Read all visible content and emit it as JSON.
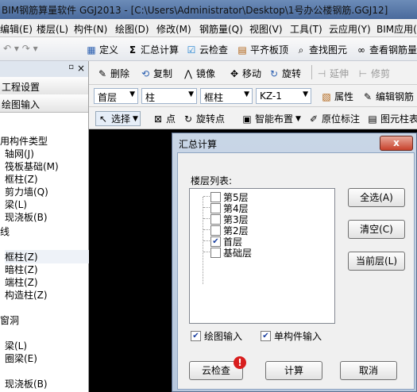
{
  "window": {
    "title": "BIM钢筋算量软件 GGJ2013 - [C:\\Users\\Administrator\\Desktop\\1号办公楼钢筋.GGJ12]"
  },
  "menubar": {
    "items": [
      "编辑(E)",
      "楼层(L)",
      "构件(N)",
      "绘图(D)",
      "修改(M)",
      "钢筋量(Q)",
      "视图(V)",
      "工具(T)",
      "云应用(Y)",
      "BIM应用("
    ]
  },
  "toolbar1": {
    "define": "定义",
    "summary": "汇总计算",
    "cloud_check": "云检查",
    "flush_slab": "平齐板顶",
    "find_element": "查找图元",
    "view_rebar": "查看钢筋量"
  },
  "edit_toolbar": {
    "delete": "删除",
    "copy": "复制",
    "mirror": "镜像",
    "move": "移动",
    "rotate": "旋转",
    "extend": "延伸",
    "trim": "修剪"
  },
  "prop_toolbar": {
    "floor": "首层",
    "element_type": "柱",
    "element_sub": "框柱",
    "element_id": "KZ-1",
    "attributes": "属性",
    "edit_rebar": "编辑钢筋"
  },
  "draw_toolbar": {
    "select": "选择",
    "point": "点",
    "rotate_point": "旋转点",
    "smart_layout": "智能布置",
    "in_situ_label": "原位标注",
    "table": "图元柱表"
  },
  "left_panel": {
    "sections": [
      "工程设置",
      "绘图输入"
    ],
    "tree": [
      {
        "label": "用构件类型",
        "icon": ""
      },
      {
        "label": "轴网(J)",
        "icon": "grid-icon"
      },
      {
        "label": "筏板基础(M)",
        "icon": "raft-icon"
      },
      {
        "label": "框柱(Z)",
        "icon": "column-icon"
      },
      {
        "label": "剪力墙(Q)",
        "icon": "wall-icon"
      },
      {
        "label": "梁(L)",
        "icon": "beam-icon"
      },
      {
        "label": "现浇板(B)",
        "icon": "slab-icon"
      },
      {
        "label": "线",
        "icon": ""
      },
      {
        "label": "框柱(Z)",
        "icon": "column-icon"
      },
      {
        "label": "暗柱(Z)",
        "icon": "column-icon"
      },
      {
        "label": "端柱(Z)",
        "icon": "column-icon"
      },
      {
        "label": "构造柱(Z)",
        "icon": "column-icon"
      },
      {
        "label": "窗洞",
        "icon": ""
      },
      {
        "label": "梁(L)",
        "icon": "beam-icon"
      },
      {
        "label": "圈梁(E)",
        "icon": "beam-icon"
      },
      {
        "label": "现浇板(B)",
        "icon": "slab-icon"
      }
    ]
  },
  "dialog": {
    "title": "汇总计算",
    "close": "x",
    "floor_list_label": "楼层列表:",
    "floors": [
      {
        "name": "第5层",
        "checked": false
      },
      {
        "name": "第4层",
        "checked": false
      },
      {
        "name": "第3层",
        "checked": false
      },
      {
        "name": "第2层",
        "checked": false
      },
      {
        "name": "首层",
        "checked": true
      },
      {
        "name": "基础层",
        "checked": false
      }
    ],
    "select_all": "全选(A)",
    "clear": "清空(C)",
    "current_floor": "当前层(L)",
    "draw_input": "绘图输入",
    "single_input": "单构件输入",
    "cloud_check": "云检查",
    "calculate": "计算",
    "cancel": "取消"
  },
  "colors": {
    "title_bg": "#4a6a9c",
    "dialog_bg": "#c9d6e6",
    "close_btn": "#c8422c",
    "alert": "#d81e1e"
  }
}
